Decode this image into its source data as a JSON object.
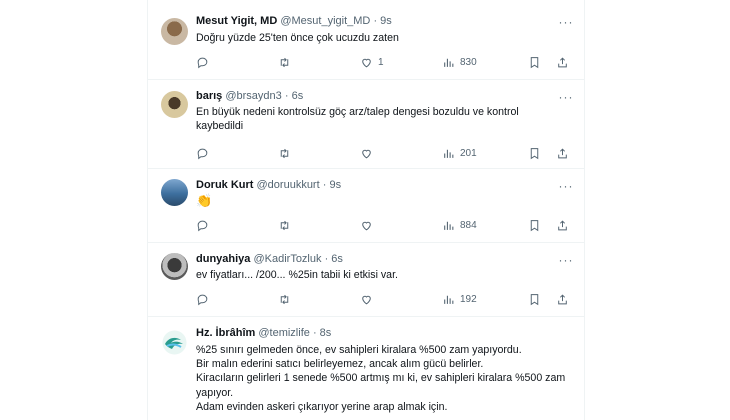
{
  "tweets": [
    {
      "name": "Mesut Yigit, MD",
      "handle": "@Mesut_yigit_MD",
      "dot": "·",
      "time": "9s",
      "text": "Doğru yüzde 25'ten önce çok ucuzdu zaten",
      "likes": "1",
      "views": "830"
    },
    {
      "name": "barış",
      "handle": "@brsaydn3",
      "dot": "·",
      "time": "6s",
      "text": "En büyük nedeni kontrolsüz göç arz/talep dengesi bozuldu ve kontrol kaybedildi",
      "likes": "",
      "views": "201"
    },
    {
      "name": "Doruk Kurt",
      "handle": "@doruukkurt",
      "dot": "·",
      "time": "9s",
      "text": "👏",
      "likes": "",
      "views": "884"
    },
    {
      "name": "dunyahiya",
      "handle": "@KadirTozluk",
      "dot": "·",
      "time": "6s",
      "text": "ev fiyatları... /200... %25in tabii ki etkisi var.",
      "likes": "",
      "views": "192"
    },
    {
      "name": "Hz. İbrâhîm",
      "handle": "@temizlife",
      "dot": "·",
      "time": "8s",
      "lines": [
        "%25 sınırı gelmeden önce, ev sahipleri kiralara %500 zam yapıyordu.",
        "Bir malın ederini satıcı belirleyemez, ancak alım gücü belirler.",
        "Kiracıların gelirleri 1 senede %500 artmış mı ki, ev sahipleri kiralara %500 zam yapıyor.",
        "Adam evinden askeri çıkarıyor yerine arap almak için."
      ]
    }
  ],
  "icons": {
    "reply": "reply-icon",
    "retweet": "retweet-icon",
    "like": "heart-icon",
    "views": "views-icon",
    "bookmark": "bookmark-icon",
    "share": "share-icon",
    "more": "more-icon"
  },
  "colors": {
    "text": "#0f1419",
    "secondary": "#536471",
    "border": "#eff3f4"
  }
}
